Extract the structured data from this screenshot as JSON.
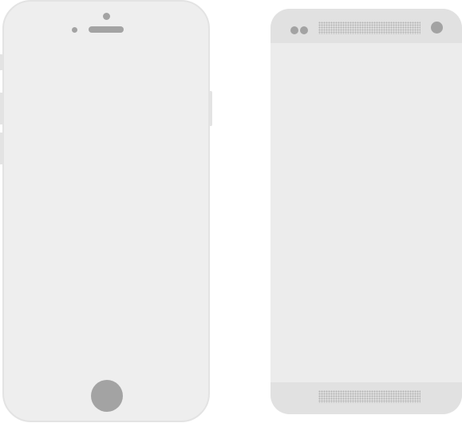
{
  "colors": {
    "background": "#ffffff",
    "phone_a_body": "#eeeeee",
    "phone_a_border": "#e3e3e3",
    "phone_b_body": "#ececec",
    "phone_b_bars": "#e1e1e1",
    "details": "#a3a3a3",
    "grille_dots": "#b4b4b4"
  },
  "devices": [
    {
      "name": "phone-a",
      "icons": [
        "front-camera-icon",
        "proximity-sensor-icon",
        "earpiece-speaker-icon",
        "home-button-icon"
      ]
    },
    {
      "name": "phone-b",
      "icons": [
        "front-sensor-icon",
        "front-camera-icon",
        "speaker-grille-icon"
      ]
    }
  ]
}
